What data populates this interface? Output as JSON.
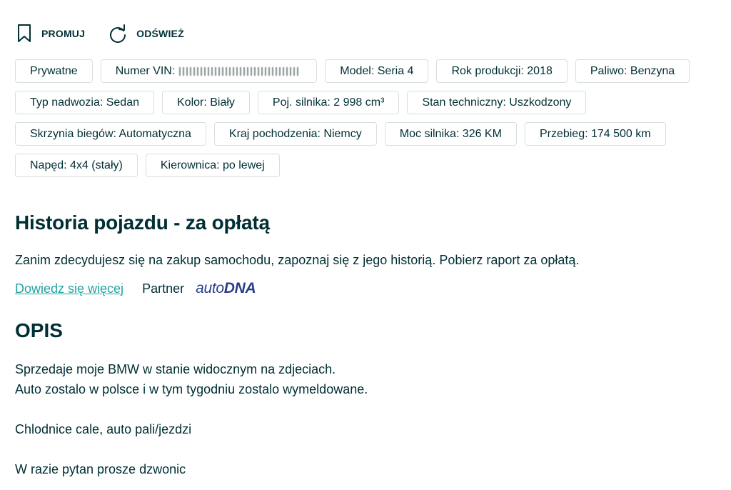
{
  "actions": {
    "promote_label": "PROMUJ",
    "refresh_label": "ODŚWIEŻ"
  },
  "params": [
    {
      "label": "Prywatne"
    },
    {
      "label": "Numer VIN:",
      "masked": true
    },
    {
      "label": "Model: Seria 4"
    },
    {
      "label": "Rok produkcji: 2018"
    },
    {
      "label": "Paliwo: Benzyna"
    },
    {
      "label": "Typ nadwozia: Sedan"
    },
    {
      "label": "Kolor: Biały"
    },
    {
      "label": "Poj. silnika: 2 998 cm³"
    },
    {
      "label": "Stan techniczny: Uszkodzony"
    },
    {
      "label": "Skrzynia biegów: Automatyczna"
    },
    {
      "label": "Kraj pochodzenia: Niemcy"
    },
    {
      "label": "Moc silnika: 326 KM"
    },
    {
      "label": "Przebieg: 174 500 km"
    },
    {
      "label": "Napęd: 4x4 (stały)"
    },
    {
      "label": "Kierownica: po lewej"
    }
  ],
  "history": {
    "title": "Historia pojazdu - za opłatą",
    "text": "Zanim zdecydujesz się na zakup samochodu, zapoznaj się z jego historią. Pobierz raport za opłatą.",
    "learn_more": "Dowiedz się więcej",
    "partner_label": "Partner",
    "partner_logo_auto": "auto",
    "partner_logo_dna": "DNA"
  },
  "description": {
    "title": "OPIS",
    "lines": [
      "Sprzedaje moje BMW w stanie widocznym na zdjeciach.",
      "Auto zostalo w polsce i w tym tygodniu zostalo wymeldowane.",
      "Chlodnice cale, auto pali/jezdzi",
      "W razie pytan prosze dzwonic"
    ]
  },
  "colors": {
    "text": "#002f34",
    "link": "#23a4a0",
    "border": "#d8dfe0",
    "autodna": "#2b3f8c"
  },
  "icons": [
    "bookmark-icon",
    "refresh-icon"
  ]
}
